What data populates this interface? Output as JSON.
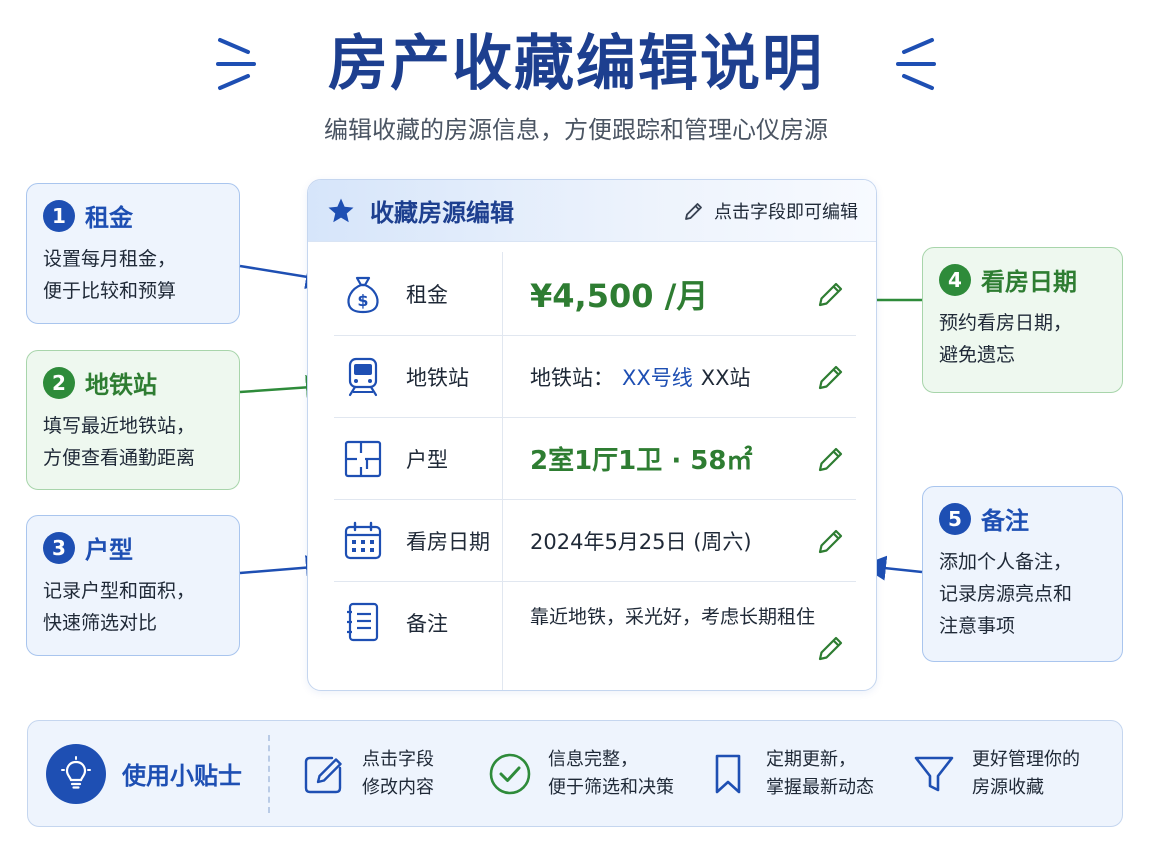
{
  "header": {
    "title": "房产收藏编辑说明",
    "subtitle": "编辑收藏的房源信息，方便跟踪和管理心仪房源"
  },
  "callouts": [
    {
      "number": "1",
      "title": "租金",
      "desc_line1": "设置每月租金，",
      "desc_line2": "便于比较和预算",
      "color": "#1e4fb3"
    },
    {
      "number": "2",
      "title": "地铁站",
      "desc_line1": "填写最近地铁站，",
      "desc_line2": "方便查看通勤距离",
      "color": "#2e8b3a"
    },
    {
      "number": "3",
      "title": "户型",
      "desc_line1": "记录户型和面积，",
      "desc_line2": "快速筛选对比",
      "color": "#1e4fb3"
    },
    {
      "number": "4",
      "title": "看房日期",
      "desc_line1": "预约看房日期，",
      "desc_line2": "避免遗忘",
      "color": "#2e8b3a"
    },
    {
      "number": "5",
      "title": "备注",
      "desc_line1": "添加个人备注，",
      "desc_line2": "记录房源亮点和",
      "desc_line3": "注意事项",
      "color": "#1e4fb3"
    }
  ],
  "card": {
    "title": "收藏房源编辑",
    "hint": "点击字段即可编辑",
    "star_icon": "star-icon",
    "rows": [
      {
        "label": "租金",
        "value": "¥4,500 /月",
        "icon": "money-bag-icon"
      },
      {
        "label": "地铁站",
        "value_prefix": "地铁站：",
        "value_line": "XX号线",
        "value_station": "XX站",
        "icon": "train-icon"
      },
      {
        "label": "户型",
        "value": "2室1厅1卫 · 58㎡",
        "icon": "floorplan-icon"
      },
      {
        "label": "看房日期",
        "value": "2024年5月25日 (周六)",
        "icon": "calendar-icon"
      },
      {
        "label": "备注",
        "value": "靠近地铁，采光好，考虑长期租住",
        "icon": "notebook-icon"
      }
    ]
  },
  "tips": {
    "title": "使用小贴士",
    "items": [
      {
        "line1": "点击字段",
        "line2": "修改内容",
        "icon": "edit-icon"
      },
      {
        "line1": "信息完整，",
        "line2": "便于筛选和决策",
        "icon": "check-circle-icon"
      },
      {
        "line1": "定期更新，",
        "line2": "掌握最新动态",
        "icon": "bookmark-icon"
      },
      {
        "line1": "更好管理你的",
        "line2": "房源收藏",
        "icon": "filter-icon"
      }
    ]
  },
  "colors": {
    "primary_blue": "#1e4fb3",
    "title_navy": "#1d3f8f",
    "accent_green": "#2e7d32"
  }
}
